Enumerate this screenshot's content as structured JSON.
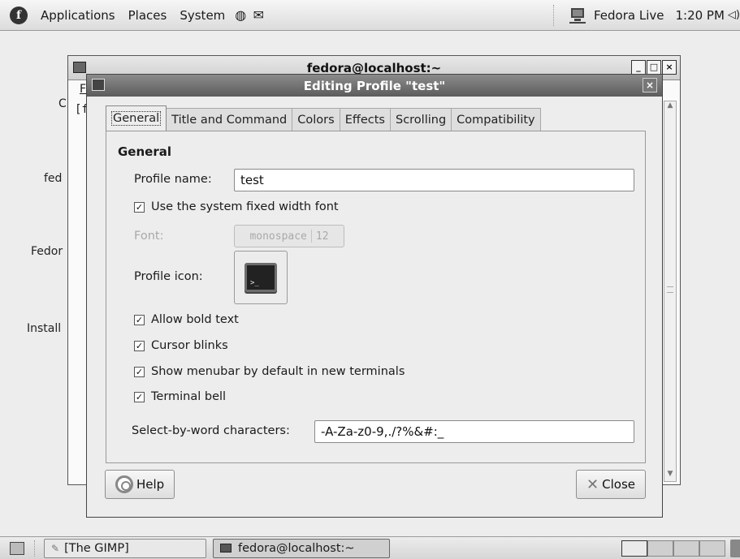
{
  "top_panel": {
    "menus": [
      "Applications",
      "Places",
      "System"
    ],
    "user": "Fedora Live",
    "clock": "1:20 PM"
  },
  "background_window": {
    "title": "fedora@localhost:~",
    "menu_fragment": "F",
    "terminal_fragment": "[f"
  },
  "desktop_fragments": [
    "C",
    "fed",
    "Fedor",
    "Install"
  ],
  "dialog": {
    "title": "Editing Profile \"test\"",
    "tabs": [
      "General",
      "Title and Command",
      "Colors",
      "Effects",
      "Scrolling",
      "Compatibility"
    ],
    "active_tab": "General",
    "section": "General",
    "profile_name_label": "Profile name:",
    "profile_name_value": "test",
    "use_system_font_label": "Use the system fixed width font",
    "use_system_font_checked": true,
    "font_label": "Font:",
    "font_name": "monospace",
    "font_size": "12",
    "profile_icon_label": "Profile icon:",
    "checkboxes": [
      {
        "label": "Allow bold text",
        "checked": true
      },
      {
        "label": "Cursor blinks",
        "checked": true
      },
      {
        "label": "Show menubar by default in new terminals",
        "checked": true
      },
      {
        "label": "Terminal bell",
        "checked": true
      }
    ],
    "word_chars_label": "Select-by-word characters:",
    "word_chars_value": "-A-Za-z0-9,./?%&#:_",
    "help_button": "Help",
    "close_button": "Close"
  },
  "bottom_panel": {
    "tasks": [
      {
        "label": "[The GIMP]",
        "active": false
      },
      {
        "label": "fedora@localhost:~",
        "active": true
      }
    ],
    "workspaces": 4,
    "active_workspace": 1
  },
  "colors": {
    "dialog_titlebar": "#6e6e6e",
    "panel": "#e4e4e4",
    "desktop": "#ededed"
  }
}
